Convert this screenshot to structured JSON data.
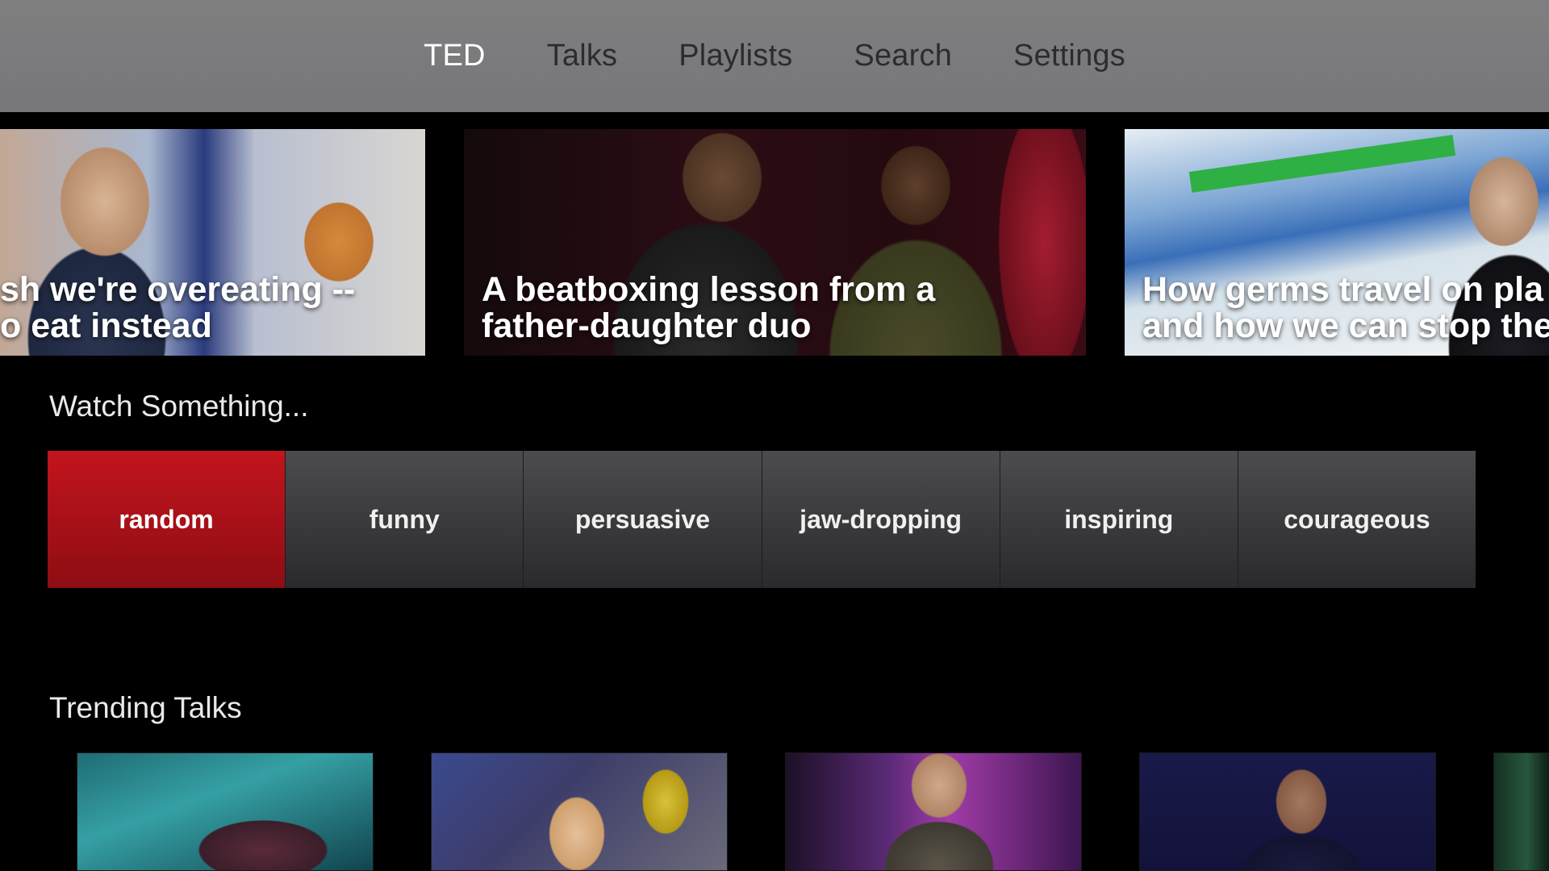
{
  "nav": {
    "tabs": [
      {
        "label": "TED",
        "active": true
      },
      {
        "label": "Talks",
        "active": false
      },
      {
        "label": "Playlists",
        "active": false
      },
      {
        "label": "Search",
        "active": false
      },
      {
        "label": "Settings",
        "active": false
      }
    ]
  },
  "featured": [
    {
      "title_line1": "sh we're overeating --",
      "title_line2": "o eat instead"
    },
    {
      "title_line1": "A beatboxing lesson from a",
      "title_line2": "father-daughter duo"
    },
    {
      "title_line1": "How germs travel on pla",
      "title_line2": "and how we can stop the"
    }
  ],
  "watch_something": {
    "heading": "Watch Something...",
    "categories": [
      "random",
      "funny",
      "persuasive",
      "jaw-dropping",
      "inspiring",
      "courageous"
    ],
    "selected": "random"
  },
  "trending": {
    "heading": "Trending Talks"
  },
  "colors": {
    "nav_bg": "#7b7b7d",
    "active_tab": "#ffffff",
    "inactive_tab": "#2c2c2e",
    "selected_category": "#b0111a",
    "category_bg": "#3a3a3c",
    "background": "#000000"
  }
}
